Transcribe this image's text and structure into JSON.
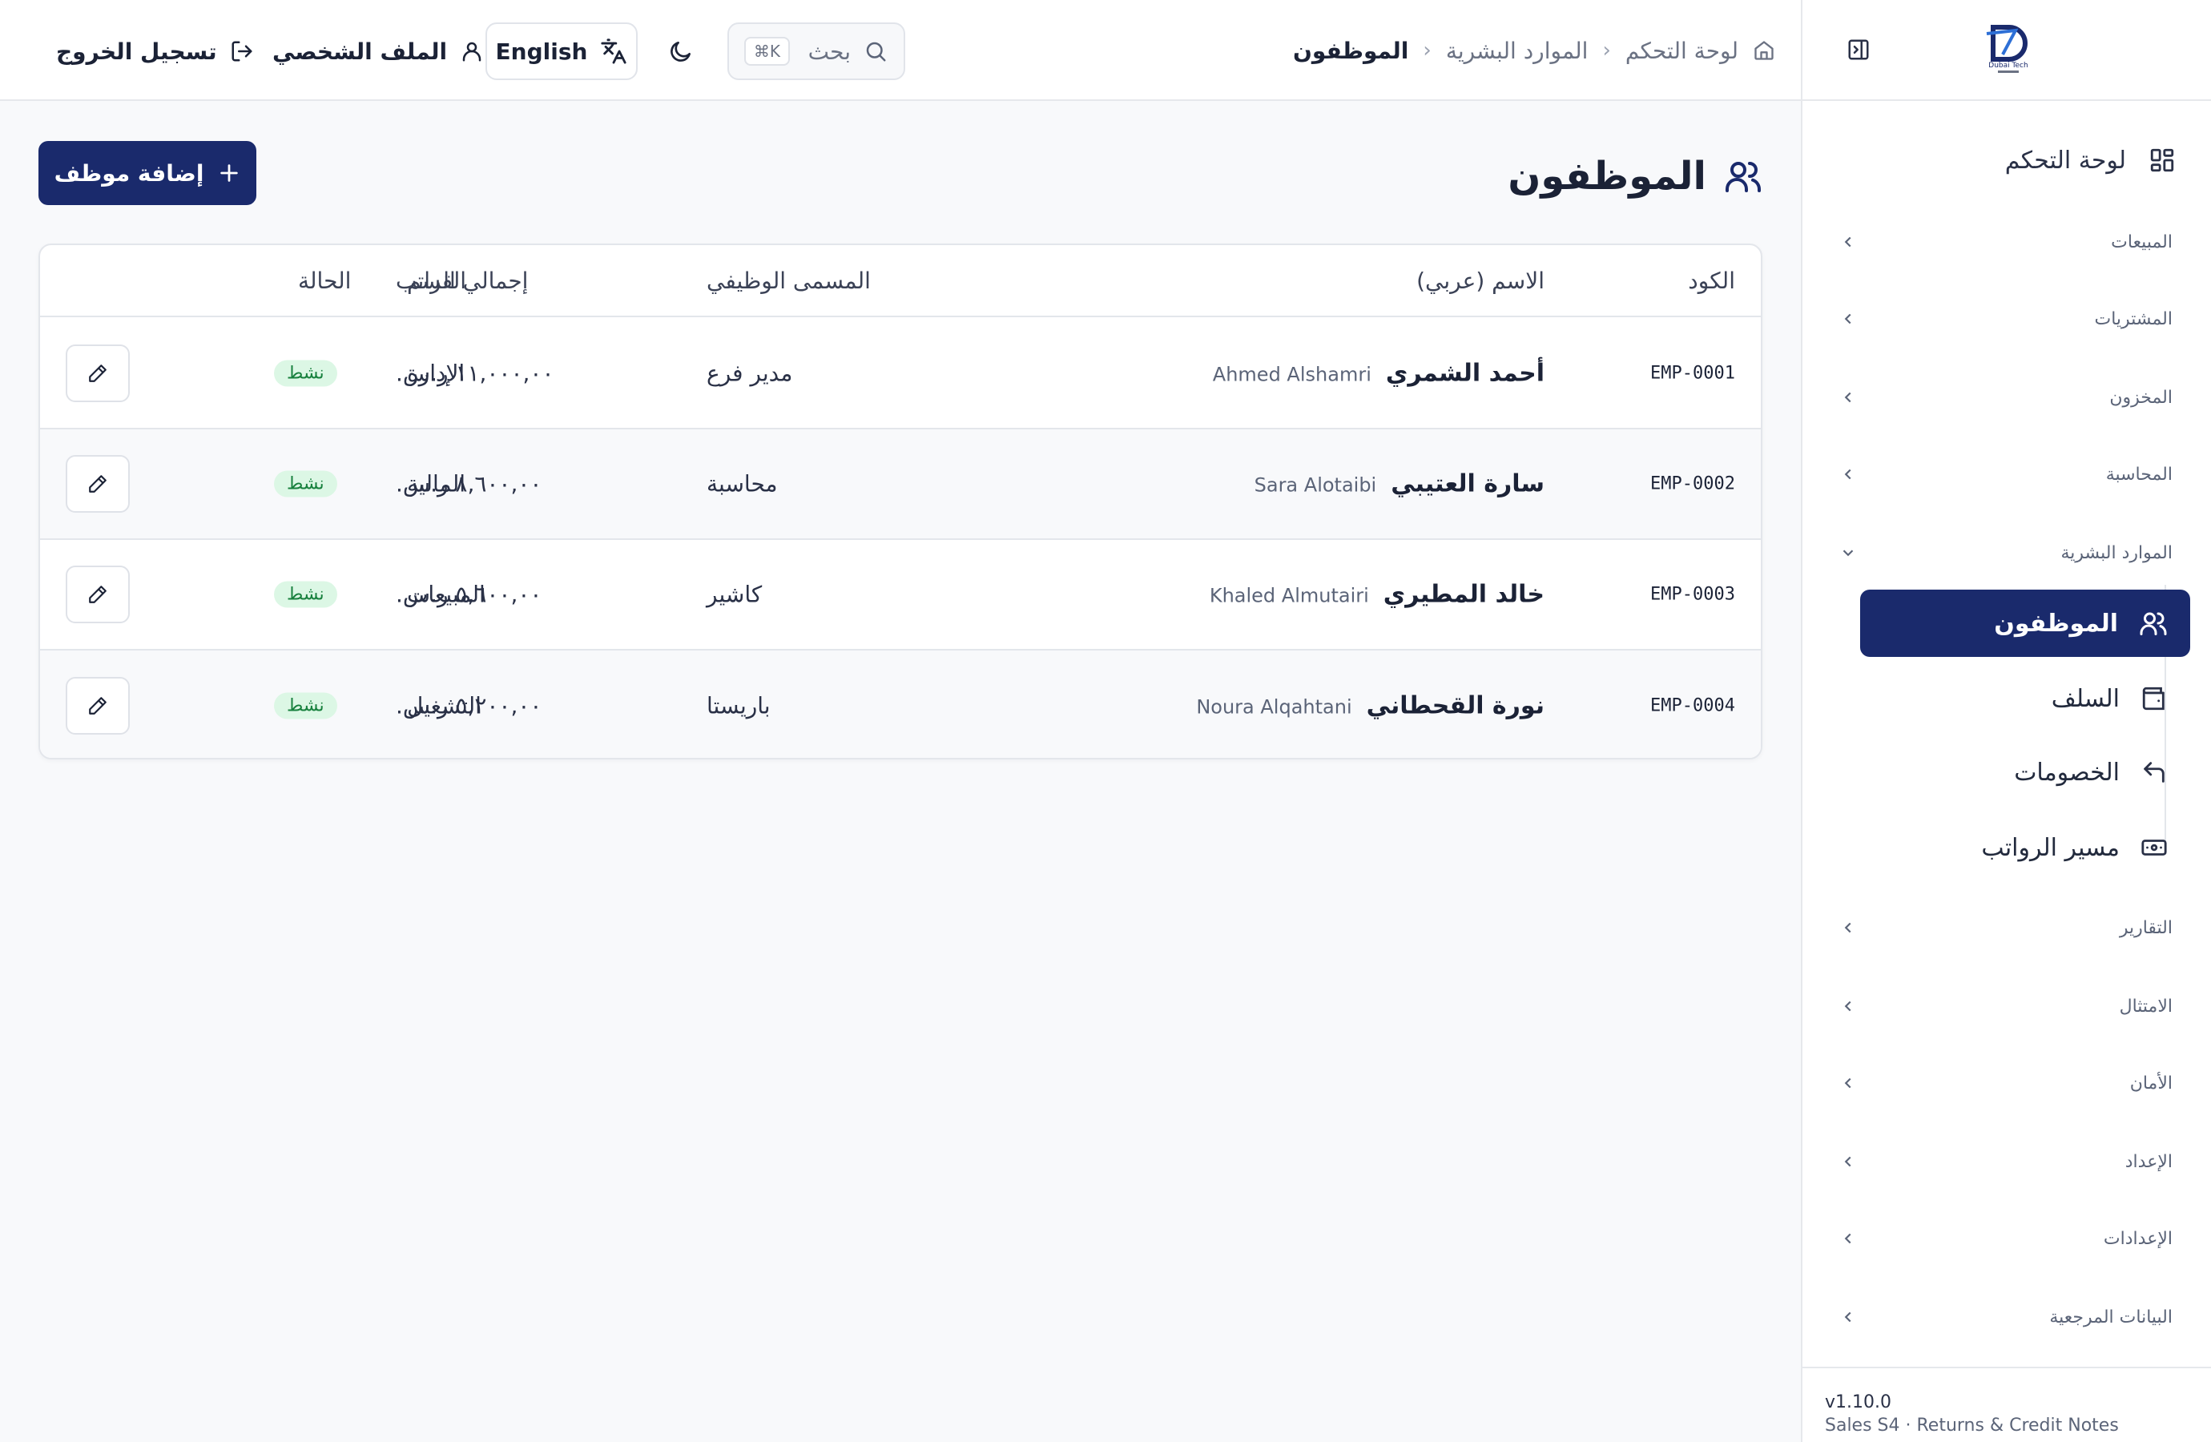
{
  "sidebar": {
    "logo_text": "Dubai Tech",
    "home_label": "لوحة التحكم",
    "groups": [
      {
        "label": "المبيعات"
      },
      {
        "label": "المشتريات"
      },
      {
        "label": "المخزون"
      },
      {
        "label": "المحاسبة"
      },
      {
        "label": "الموارد البشرية"
      },
      {
        "label": "التقارير"
      },
      {
        "label": "الامتثال"
      },
      {
        "label": "الأمان"
      },
      {
        "label": "الإعداد"
      },
      {
        "label": "الإعدادات"
      },
      {
        "label": "البيانات المرجعية"
      }
    ],
    "hr_items": [
      {
        "label": "الموظفون",
        "icon": "users-icon"
      },
      {
        "label": "السلف",
        "icon": "wallet-icon"
      },
      {
        "label": "الخصومات",
        "icon": "undo-icon"
      },
      {
        "label": "مسير الرواتب",
        "icon": "banknote-icon"
      }
    ],
    "version": "v1.10.0",
    "release": "Sales S4 · Returns & Credit Notes"
  },
  "topbar": {
    "breadcrumb": [
      "لوحة التحكم",
      "الموارد البشرية",
      "الموظفون"
    ],
    "search_placeholder": "بحث",
    "search_shortcut": "⌘K",
    "language_label": "English",
    "profile_label": "الملف الشخصي",
    "logout_label": "تسجيل الخروج"
  },
  "page": {
    "title": "الموظفون",
    "add_button": "إضافة موظف"
  },
  "table": {
    "headers": {
      "code": "الكود",
      "name": "الاسم (عربي)",
      "title": "المسمى الوظيفي",
      "department": "القسم",
      "salary": "إجمالي الراتب",
      "status": "الحالة"
    },
    "rows": [
      {
        "code": "EMP-0001",
        "name_ar": "أحمد الشمري",
        "name_en": "Ahmed Alshamri",
        "title": "مدير فرع",
        "department": "الإدارة",
        "salary": "١١,٠٠٠,٠٠ ر.س.",
        "status": "نشط"
      },
      {
        "code": "EMP-0002",
        "name_ar": "سارة العتيبي",
        "name_en": "Sara Alotaibi",
        "title": "محاسبة",
        "department": "المالية",
        "salary": "٨,٦٠٠,٠٠ ر.س.",
        "status": "نشط"
      },
      {
        "code": "EMP-0003",
        "name_ar": "خالد المطيري",
        "name_en": "Khaled Almutairi",
        "title": "كاشير",
        "department": "المبيعات",
        "salary": "٥,٦٠٠,٠٠ ر.س.",
        "status": "نشط"
      },
      {
        "code": "EMP-0004",
        "name_ar": "نورة القحطاني",
        "name_en": "Noura Alqahtani",
        "title": "باريستا",
        "department": "التشغيل",
        "salary": "٥,٢٠٠,٠٠ ر.س.",
        "status": "نشط"
      }
    ]
  },
  "colors": {
    "primary": "#1a2a6c",
    "active_badge_bg": "#dcf7e5",
    "active_badge_text": "#17803d",
    "border": "#e3e6eb"
  }
}
